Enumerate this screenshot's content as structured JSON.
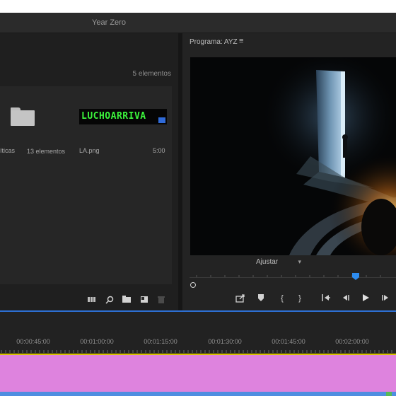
{
  "window": {
    "title": "Year Zero"
  },
  "project": {
    "item_count": "5 elementos",
    "items": [
      {
        "name": "íticas",
        "meta": ""
      },
      {
        "name": "",
        "meta": "13 elementos"
      },
      {
        "name": "LA.png",
        "meta": "5:00"
      }
    ],
    "image_text": "LUCHOARRIVA",
    "toolbar_icons": [
      "freeform-view-icon",
      "search-icon",
      "new-bin-icon",
      "new-item-icon",
      "trash-icon"
    ]
  },
  "program": {
    "title": "Programa: AYZ",
    "menu_icon": "hamburger-menu-icon",
    "fit_label": "Ajustar",
    "playhead_position": 0.79,
    "transport_icons": [
      "export-frame-icon",
      "add-marker-icon",
      "mark-in-icon",
      "mark-out-icon",
      "go-to-in-icon",
      "step-back-icon",
      "play-icon",
      "step-forward-icon"
    ]
  },
  "timeline": {
    "timecodes": [
      "00:00:45:00",
      "00:01:00:00",
      "00:01:15:00",
      "00:01:30:00",
      "00:01:45:00",
      "00:02:00:00"
    ]
  },
  "colors": {
    "accent_blue": "#2d6fd3",
    "clip_pink": "#de83de",
    "work_area": "#d9c200",
    "image_text_green": "#3cf53c"
  }
}
